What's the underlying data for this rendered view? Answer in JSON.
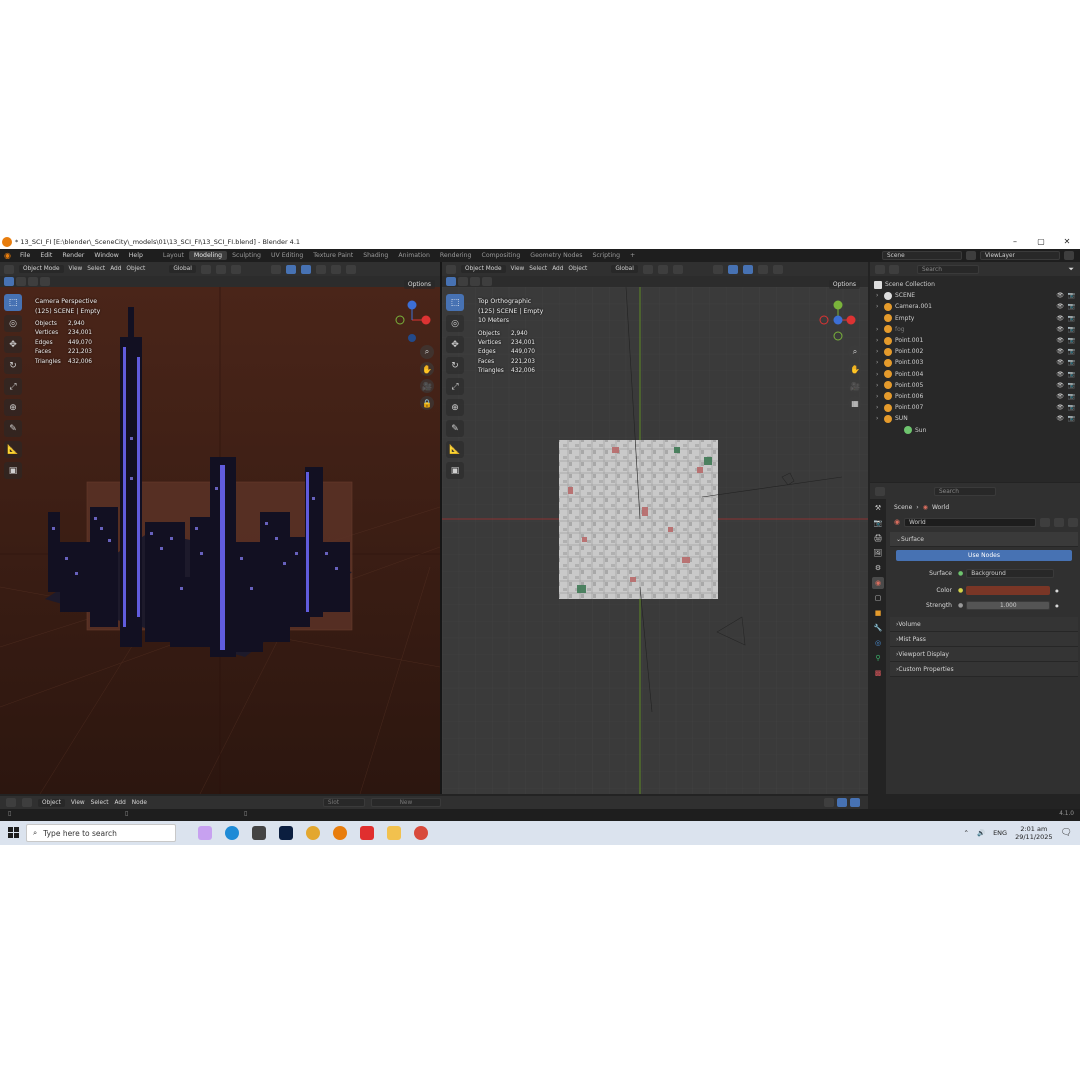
{
  "window": {
    "title": "* 13_SCI_FI [E:\\blender\\_SceneCity\\_models\\01\\13_SCI_FI\\13_SCI_FI.blend] - Blender 4.1",
    "controls": [
      "–",
      "▢",
      "✕"
    ]
  },
  "menubar": {
    "menus": [
      "File",
      "Edit",
      "Render",
      "Window",
      "Help"
    ],
    "workspaces": [
      "Layout",
      "Modeling",
      "Sculpting",
      "UV Editing",
      "Texture Paint",
      "Shading",
      "Animation",
      "Rendering",
      "Compositing",
      "Geometry Nodes",
      "Scripting"
    ],
    "active_workspace": "Modeling",
    "add_workspace": "+",
    "scene": "Scene",
    "view_layer": "ViewLayer"
  },
  "viewport_left": {
    "mode": "Object Mode",
    "menus": [
      "View",
      "Select",
      "Add",
      "Object"
    ],
    "transform": "Global",
    "options": "Options",
    "view_name": "Camera Perspective",
    "collection": "(125) SCENE | Empty",
    "stats": [
      {
        "label": "Objects",
        "value": "2,940"
      },
      {
        "label": "Vertices",
        "value": "234,001"
      },
      {
        "label": "Edges",
        "value": "449,070"
      },
      {
        "label": "Faces",
        "value": "221,203"
      },
      {
        "label": "Triangles",
        "value": "432,006"
      }
    ],
    "background_color": "#3d2016"
  },
  "viewport_right": {
    "mode": "Object Mode",
    "menus": [
      "View",
      "Select",
      "Add",
      "Object"
    ],
    "transform": "Global",
    "options": "Options",
    "view_name": "Top Orthographic",
    "collection": "(125) SCENE | Empty",
    "scale": "10 Meters",
    "stats": [
      {
        "label": "Objects",
        "value": "2,940"
      },
      {
        "label": "Vertices",
        "value": "234,001"
      },
      {
        "label": "Edges",
        "value": "449,070"
      },
      {
        "label": "Faces",
        "value": "221,203"
      },
      {
        "label": "Triangles",
        "value": "432,006"
      }
    ]
  },
  "gizmo": {
    "x": "X",
    "y": "Y",
    "z": "Z"
  },
  "outliner": {
    "search_placeholder": "Search",
    "root": "Scene Collection",
    "items": [
      {
        "name": "SCENE",
        "icon": "collection-icon",
        "color": "#cfcfcf"
      },
      {
        "name": "Camera.001",
        "icon": "camera-icon",
        "color": "#cfcfcf"
      },
      {
        "name": "Empty",
        "icon": "empty-icon",
        "color": "#cfcfcf"
      },
      {
        "name": "fog",
        "icon": "light-icon",
        "color": "#7a7a7a"
      },
      {
        "name": "Point.001",
        "icon": "light-icon",
        "color": "#cfcfcf"
      },
      {
        "name": "Point.002",
        "icon": "light-icon",
        "color": "#cfcfcf"
      },
      {
        "name": "Point.003",
        "icon": "light-icon",
        "color": "#cfcfcf"
      },
      {
        "name": "Point.004",
        "icon": "light-icon",
        "color": "#cfcfcf"
      },
      {
        "name": "Point.005",
        "icon": "light-icon",
        "color": "#cfcfcf"
      },
      {
        "name": "Point.006",
        "icon": "light-icon",
        "color": "#cfcfcf"
      },
      {
        "name": "Point.007",
        "icon": "light-icon",
        "color": "#cfcfcf"
      },
      {
        "name": "SUN",
        "icon": "light-icon",
        "color": "#cfcfcf"
      },
      {
        "name": "Sun",
        "icon": "light-data-icon",
        "color": "#cfcfcf"
      }
    ]
  },
  "properties": {
    "search_placeholder": "Search",
    "breadcrumb": [
      "Scene",
      "World"
    ],
    "world_name": "World",
    "panels": {
      "surface": "Surface",
      "use_nodes": "Use Nodes",
      "surface_label": "Surface",
      "surface_value": "Background",
      "color_label": "Color",
      "color_value": "#7a3626",
      "strength_label": "Strength",
      "strength_value": "1.000",
      "collapsed": [
        "Volume",
        "Mist Pass",
        "Viewport Display",
        "Custom Properties"
      ]
    }
  },
  "node_editor": {
    "mode": "Object",
    "menus": [
      "View",
      "Select",
      "Add",
      "Node"
    ],
    "slot": "Slot",
    "new_label": "New"
  },
  "statusbar": {
    "version": "4.1.0"
  },
  "taskbar": {
    "search_placeholder": "Type here to search",
    "language": "ENG",
    "time": "2:01 am",
    "date": "29/11/2025"
  }
}
